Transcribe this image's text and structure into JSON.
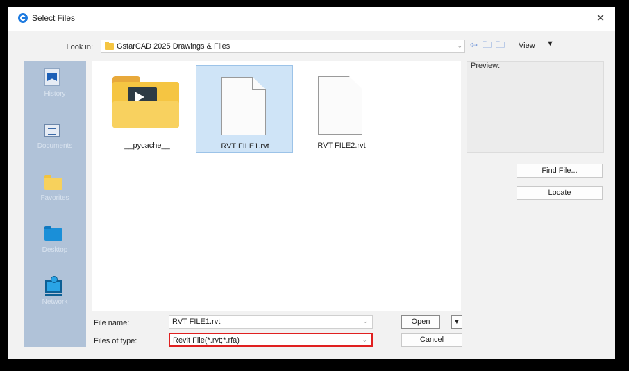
{
  "window": {
    "title": "Select Files"
  },
  "lookin": {
    "label": "Look in:",
    "value": "GstarCAD 2025 Drawings & Files"
  },
  "toolbar": {
    "back_icon": "⇦",
    "up_icon": "🗀",
    "new_folder_icon": "🗀",
    "view_label": "View",
    "view_arrow": "▼"
  },
  "places": [
    {
      "name": "history",
      "label": "History"
    },
    {
      "name": "documents",
      "label": "Documents"
    },
    {
      "name": "favorites",
      "label": "Favorites"
    },
    {
      "name": "desktop",
      "label": "Desktop"
    },
    {
      "name": "network",
      "label": "Network"
    }
  ],
  "files": [
    {
      "name": "__pycache__",
      "type": "folder",
      "selected": false
    },
    {
      "name": "RVT FILE1.rvt",
      "type": "file",
      "selected": true
    },
    {
      "name": "RVT FILE2.rvt",
      "type": "file",
      "selected": false
    }
  ],
  "preview": {
    "label": "Preview:"
  },
  "buttons": {
    "find_file": "Find File...",
    "locate": "Locate",
    "open": "Open",
    "cancel": "Cancel"
  },
  "filename": {
    "label": "File name:",
    "value": "RVT FILE1.rvt"
  },
  "filetype": {
    "label": "Files of type:",
    "value": "Revit File(*.rvt;*.rfa)"
  },
  "colors": {
    "highlight_border": "#e02020",
    "places_bg": "#b0c2d8",
    "selection_bg": "#cfe4f7"
  }
}
